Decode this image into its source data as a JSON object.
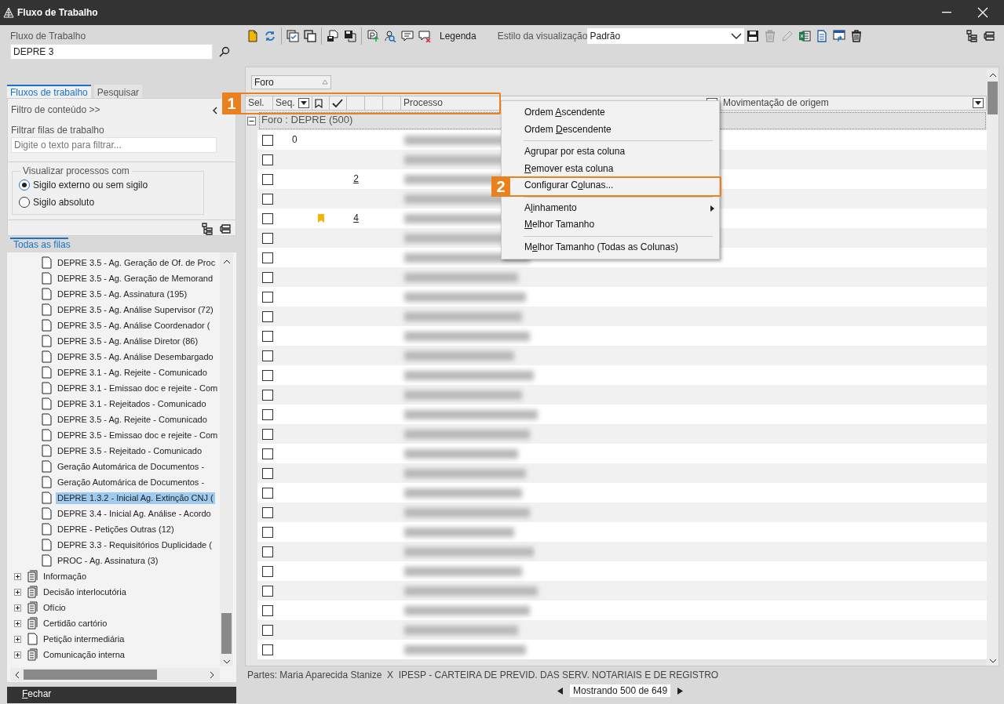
{
  "window": {
    "title": "Fluxo de Trabalho"
  },
  "left": {
    "workflow_label": "Fluxo de Trabalho",
    "workflow_value": "DEPRE 3",
    "tabs": [
      {
        "label": "Fluxos de trabalho",
        "selected": true
      },
      {
        "label": "Pesquisar",
        "selected": false
      }
    ],
    "content_filter": "Filtro de conteúdo >>",
    "queue_filter_label": "Filtrar filas de trabalho",
    "queue_filter_placeholder": "Digite o texto para filtrar...",
    "view_group": {
      "legend": "Visualizar processos com",
      "options": [
        {
          "label": "Sigilo externo ou sem sigilo",
          "selected": true
        },
        {
          "label": "Sigilo absoluto",
          "selected": false
        }
      ]
    },
    "queue_tab": "Todas as filas",
    "tree": {
      "scrolled_branch_children": [
        {
          "label": "DEPRE 3.5 - Ag. Geração de Of. de Proc",
          "selected": false
        },
        {
          "label": "DEPRE 3.5 - Ag. Geração de Memorand",
          "selected": false
        },
        {
          "label": "DEPRE 3.5 - Ag. Assinatura (195)",
          "selected": false
        },
        {
          "label": "DEPRE 3.5 - Ag. Análise Supervisor (72)",
          "selected": false
        },
        {
          "label": "DEPRE 3.5 - Ag. Análise Coordenador (",
          "selected": false
        },
        {
          "label": "DEPRE 3.5 - Ag. Análise Diretor (86)",
          "selected": false
        },
        {
          "label": "DEPRE 3.5 - Ag. Análise Desembargado",
          "selected": false
        },
        {
          "label": "DEPRE 3.1 - Ag. Rejeite - Comunicado",
          "selected": false
        },
        {
          "label": "DEPRE 3.1 - Emissao doc e rejeite - Com",
          "selected": false
        },
        {
          "label": "DEPRE 3.1 - Rejeitados - Comunicado",
          "selected": false
        },
        {
          "label": "DEPRE 3.5 - Ag. Rejeite - Comunicado",
          "selected": false
        },
        {
          "label": "DEPRE 3.5 - Emissao doc e rejeite - Com",
          "selected": false
        },
        {
          "label": "DEPRE 3.5 - Rejeitado - Comunicado",
          "selected": false
        },
        {
          "label": "Geração Automárica de Documentos - ",
          "selected": false
        },
        {
          "label": "Geração Automárica de Documentos - ",
          "selected": false
        },
        {
          "label": "DEPRE 1.3.2 - Inicial Ag. Extinção CNJ (",
          "selected": true
        },
        {
          "label": "DEPRE 3.4 - Inicial Ag. Análise - Acordo",
          "selected": false
        },
        {
          "label": "DEPRE - Petições Outras (12)",
          "selected": false
        },
        {
          "label": "DEPRE 3.3 - Requisitórios Duplicidade (",
          "selected": false
        },
        {
          "label": "PROC - Ag. Assinatura (3)",
          "selected": false
        }
      ],
      "nodes": [
        {
          "label": "Informação",
          "kind": "stack",
          "expanded": false
        },
        {
          "label": "Decisão interlocutória",
          "kind": "stack",
          "expanded": false
        },
        {
          "label": "Ofício",
          "kind": "stack",
          "expanded": false
        },
        {
          "label": "Certidão cartório",
          "kind": "stack",
          "expanded": false
        },
        {
          "label": "Petição intermediária",
          "kind": "page",
          "expanded": false
        },
        {
          "label": "Comunicação interna",
          "kind": "stack",
          "expanded": false
        }
      ]
    },
    "close_button": {
      "key": "F",
      "after": "echar"
    }
  },
  "toolbar": {
    "actions": [
      {
        "kind": "note"
      },
      {
        "kind": "refresh"
      },
      {
        "kind": "separator"
      },
      {
        "kind": "checklist"
      },
      {
        "kind": "copy"
      },
      {
        "kind": "separator"
      },
      {
        "kind": "doc-save"
      },
      {
        "kind": "save-copy"
      },
      {
        "kind": "separator"
      },
      {
        "kind": "upload"
      },
      {
        "kind": "user-search"
      },
      {
        "kind": "comment"
      },
      {
        "kind": "comment-delete"
      }
    ],
    "legend": "Legenda",
    "style_label": "Estilo da visualização",
    "style_value": "Padrão",
    "style_actions": [
      {
        "kind": "save",
        "disabled": false
      },
      {
        "kind": "trash",
        "disabled": true
      },
      {
        "kind": "pencil",
        "disabled": true
      },
      {
        "kind": "spreadsheet",
        "disabled": false
      },
      {
        "kind": "document",
        "disabled": false
      },
      {
        "kind": "window",
        "disabled": false
      },
      {
        "kind": "trash",
        "disabled": false
      }
    ]
  },
  "grid": {
    "group_chip": "Foro",
    "columns": [
      {
        "kind": "text",
        "label": "Sel.",
        "filter": false
      },
      {
        "kind": "text",
        "label": "Seq.",
        "filter": true
      },
      {
        "kind": "bookmark",
        "filter": false
      },
      {
        "kind": "check",
        "filter": false
      },
      {
        "kind": "blank",
        "filter": false
      },
      {
        "kind": "blank",
        "filter": false
      },
      {
        "kind": "blank",
        "filter": false
      },
      {
        "kind": "text",
        "label": "Processo",
        "filter": true
      },
      {
        "kind": "text",
        "label": "Movimentação de origem",
        "filter": true
      }
    ],
    "group_row": {
      "label": "Foro : DEPRE  (500)",
      "expanded": true
    },
    "rows": [
      {
        "checked": false,
        "seq": "0",
        "bookmarked": false
      },
      {
        "checked": false,
        "bookmarked": false
      },
      {
        "checked": false,
        "number": "2",
        "bookmarked": false
      },
      {
        "checked": false,
        "bookmarked": false
      },
      {
        "checked": false,
        "number": "4",
        "bookmarked": true
      },
      {
        "checked": false,
        "bookmarked": false
      },
      {
        "checked": false,
        "bookmarked": false
      },
      {
        "checked": false,
        "bookmarked": false
      },
      {
        "checked": false,
        "bookmarked": false
      },
      {
        "checked": false,
        "bookmarked": false
      },
      {
        "checked": false,
        "bookmarked": false
      },
      {
        "checked": false,
        "bookmarked": false
      },
      {
        "checked": false,
        "bookmarked": false
      },
      {
        "checked": false,
        "bookmarked": false
      },
      {
        "checked": false,
        "bookmarked": false
      },
      {
        "checked": false,
        "bookmarked": false
      },
      {
        "checked": false,
        "bookmarked": false
      },
      {
        "checked": false,
        "bookmarked": false
      },
      {
        "checked": false,
        "bookmarked": false
      },
      {
        "checked": false,
        "bookmarked": false
      },
      {
        "checked": false,
        "bookmarked": false
      },
      {
        "checked": false,
        "bookmarked": false
      },
      {
        "checked": false,
        "bookmarked": false
      },
      {
        "checked": false,
        "bookmarked": false
      },
      {
        "checked": false,
        "bookmarked": false
      },
      {
        "checked": false,
        "bookmarked": false
      },
      {
        "checked": false,
        "bookmarked": false
      }
    ]
  },
  "context_menu": [
    {
      "kind": "item",
      "before": "Ordem ",
      "key": "A",
      "after": "scendente",
      "submenu": false
    },
    {
      "kind": "item",
      "before": "Ordem ",
      "key": "D",
      "after": "escendente",
      "submenu": false
    },
    {
      "kind": "separator"
    },
    {
      "kind": "item",
      "before": "A",
      "key": "g",
      "after": "rupar por esta coluna",
      "submenu": false
    },
    {
      "kind": "item",
      "key": "R",
      "after": "emover esta coluna",
      "submenu": false
    },
    {
      "kind": "item",
      "before": "Configurar C",
      "key": "o",
      "after": "lunas...",
      "submenu": false
    },
    {
      "kind": "separator"
    },
    {
      "kind": "item",
      "before": "A",
      "key": "l",
      "after": "inhamento",
      "submenu": true
    },
    {
      "kind": "item",
      "key": "M",
      "after": "elhor Tamanho",
      "submenu": false
    },
    {
      "kind": "separator"
    },
    {
      "kind": "item",
      "before": "M",
      "key": "e",
      "after": "lhor Tamanho (Todas as Colunas)",
      "submenu": false
    }
  ],
  "callouts": [
    {
      "number": "1"
    },
    {
      "number": "2"
    }
  ],
  "status": {
    "parties": "Partes: Maria Aparecida Stanize  X  IPESP - CARTEIRA DE PREVID. DAS SERV. NOTARIAIS E DE REGISTRO",
    "paging": "Mostrando 500 de 649"
  }
}
